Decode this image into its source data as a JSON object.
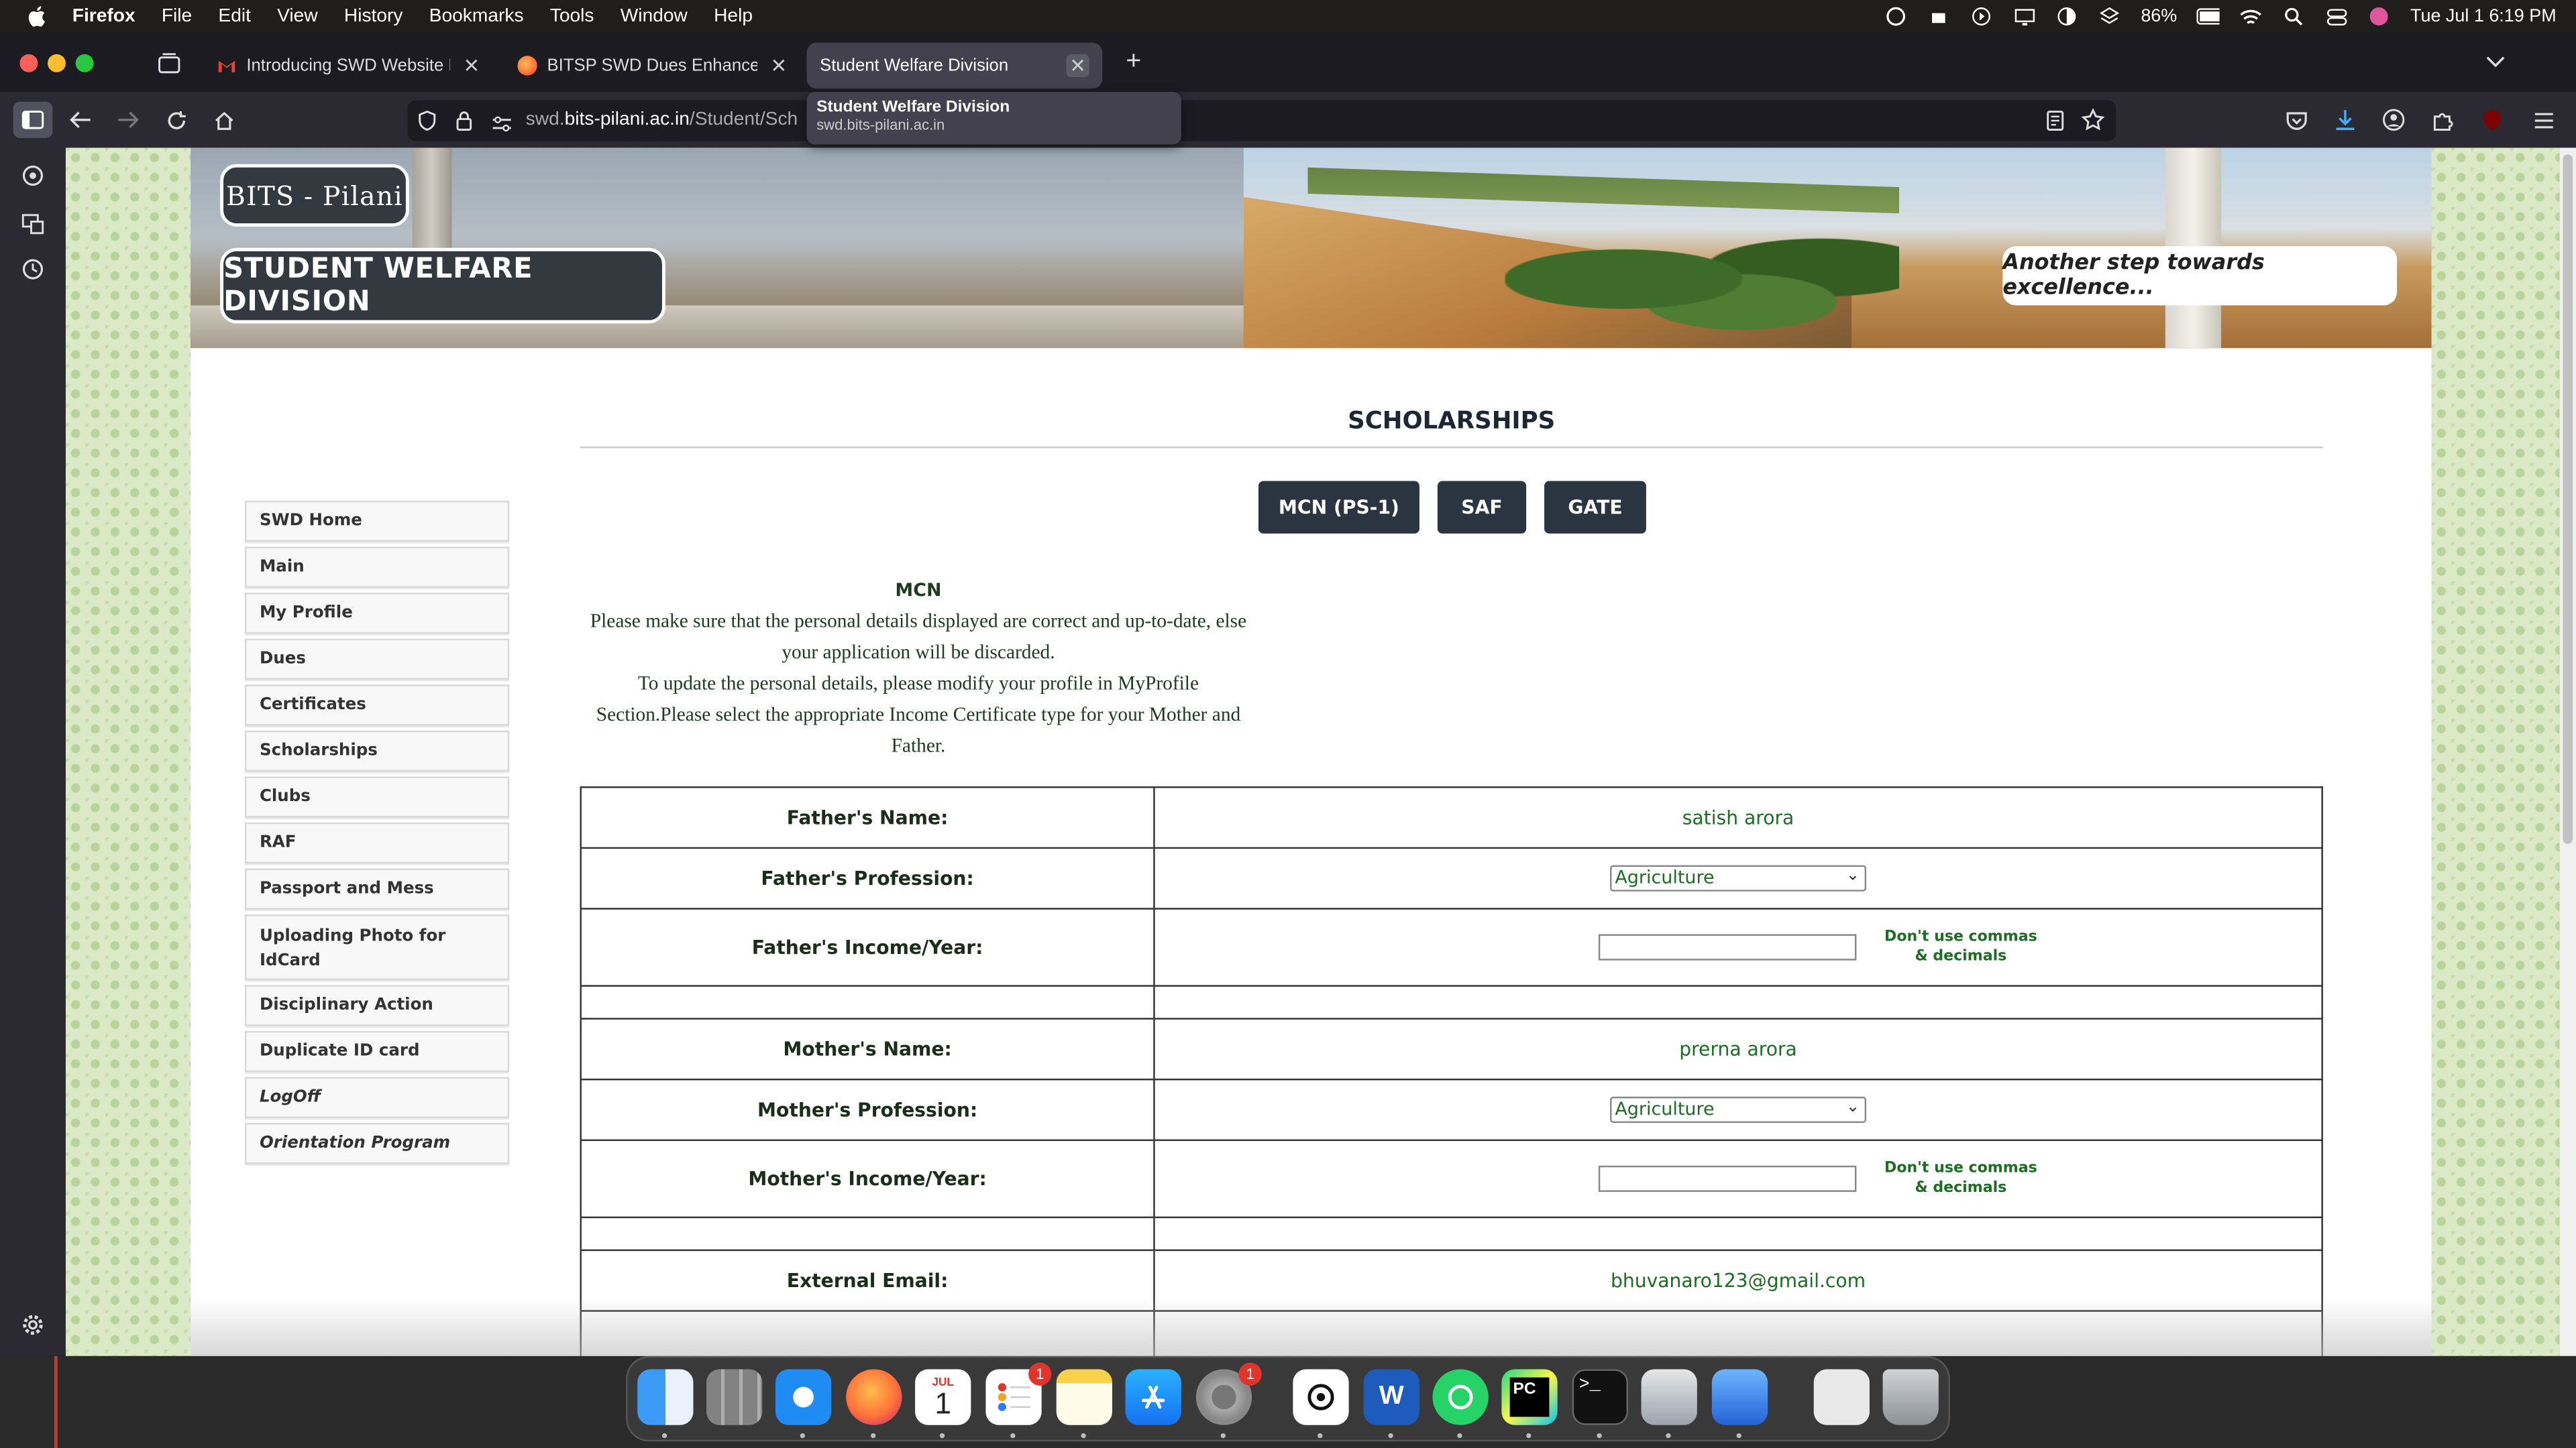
{
  "menubar": {
    "app": "Firefox",
    "items": [
      "File",
      "Edit",
      "View",
      "History",
      "Bookmarks",
      "Tools",
      "Window",
      "Help"
    ],
    "battery": "86%",
    "datetime": "Tue Jul 1  6:19 PM"
  },
  "tabs": [
    {
      "title": "Introducing SWD Website Enha",
      "favicon_color": "#ea4335"
    },
    {
      "title": "BITSP SWD Dues Enhancer – Gi",
      "favicon_color": "#ff7139"
    },
    {
      "title": "Student Welfare Division",
      "favicon_color": ""
    }
  ],
  "url": {
    "prefix": "swd.",
    "domain": "bits-pilani.ac.in",
    "path": "/Student/Sch"
  },
  "tooltip": {
    "title": "Student Welfare Division",
    "url": "swd.bits-pilani.ac.in"
  },
  "banner": {
    "logo_top": "BITS - Pilani",
    "logo_bottom": "STUDENT WELFARE DIVISION",
    "tagline": "Another step towards excellence..."
  },
  "sidenav": [
    "SWD Home",
    "Main",
    "My Profile",
    "Dues",
    "Certificates",
    "Scholarships",
    "Clubs",
    "RAF",
    "Passport and Mess",
    "Uploading Photo for IdCard",
    "Disciplinary Action",
    "Duplicate ID card",
    "LogOff",
    "Orientation Program"
  ],
  "main": {
    "heading": "SCHOLARSHIPS",
    "buttons": [
      "MCN (PS-1)",
      "SAF",
      "GATE"
    ],
    "notice_title": "MCN",
    "notice_l1": "Please make sure that the personal details displayed are correct and up-to-date, else your application will be discarded.",
    "notice_l2": "To update the personal details, please modify your profile in MyProfile Section.Please select the appropriate Income Certificate type for your Mother and Father."
  },
  "form": {
    "father_name_label": "Father's Name:",
    "father_name": "satish arora",
    "father_prof_label": "Father's Profession:",
    "father_prof": "Agriculture",
    "father_income_label": "Father's Income/Year:",
    "income_hint": "Don't use commas & decimals",
    "mother_name_label": "Mother's Name:",
    "mother_name": "prerna arora",
    "mother_prof_label": "Mother's Profession:",
    "mother_prof": "Agriculture",
    "mother_income_label": "Mother's Income/Year:",
    "email_label": "External Email:",
    "email": "bhuvanaro123@gmail.com"
  },
  "dock": {
    "calendar_month": "JUL",
    "calendar_day": "1",
    "reminders_badge": "1",
    "settings_badge": "1"
  }
}
